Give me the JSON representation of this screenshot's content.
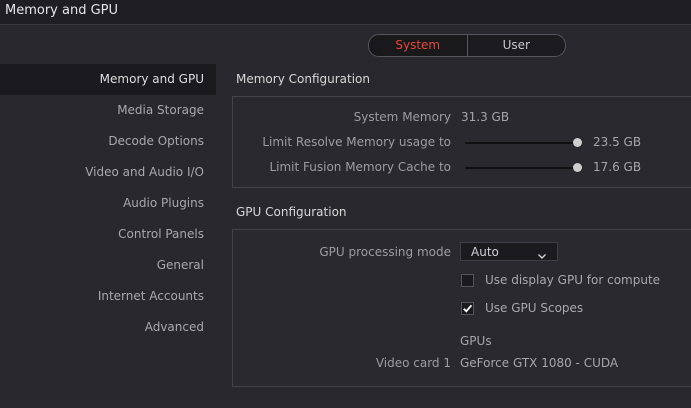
{
  "window": {
    "title": "Memory and GPU"
  },
  "scope_toggle": {
    "options": [
      "System",
      "User"
    ],
    "selected": "System"
  },
  "sidebar": {
    "items": [
      {
        "label": "Memory and GPU",
        "active": true
      },
      {
        "label": "Media Storage"
      },
      {
        "label": "Decode Options"
      },
      {
        "label": "Video and Audio I/O"
      },
      {
        "label": "Audio Plugins"
      },
      {
        "label": "Control Panels"
      },
      {
        "label": "General"
      },
      {
        "label": "Internet Accounts"
      },
      {
        "label": "Advanced"
      }
    ]
  },
  "memory": {
    "section_title": "Memory Configuration",
    "system_memory_label": "System Memory",
    "system_memory_value": "31.3 GB",
    "resolve_limit_label": "Limit Resolve Memory usage to",
    "resolve_limit_value": "23.5 GB",
    "resolve_limit_fraction": 1.0,
    "fusion_cache_label": "Limit Fusion Memory Cache to",
    "fusion_cache_value": "17.6 GB",
    "fusion_cache_fraction": 1.0
  },
  "gpu": {
    "section_title": "GPU Configuration",
    "processing_mode_label": "GPU processing mode",
    "processing_mode_value": "Auto",
    "display_gpu_label": "Use display GPU for compute",
    "display_gpu_checked": false,
    "scopes_label": "Use GPU Scopes",
    "scopes_checked": true,
    "gpus_heading": "GPUs",
    "card_label": "Video card 1",
    "card_value": "GeForce GTX 1080 - CUDA"
  },
  "colors": {
    "accent": "#e5473d",
    "background": "#28282e",
    "panel": "#29292f"
  }
}
